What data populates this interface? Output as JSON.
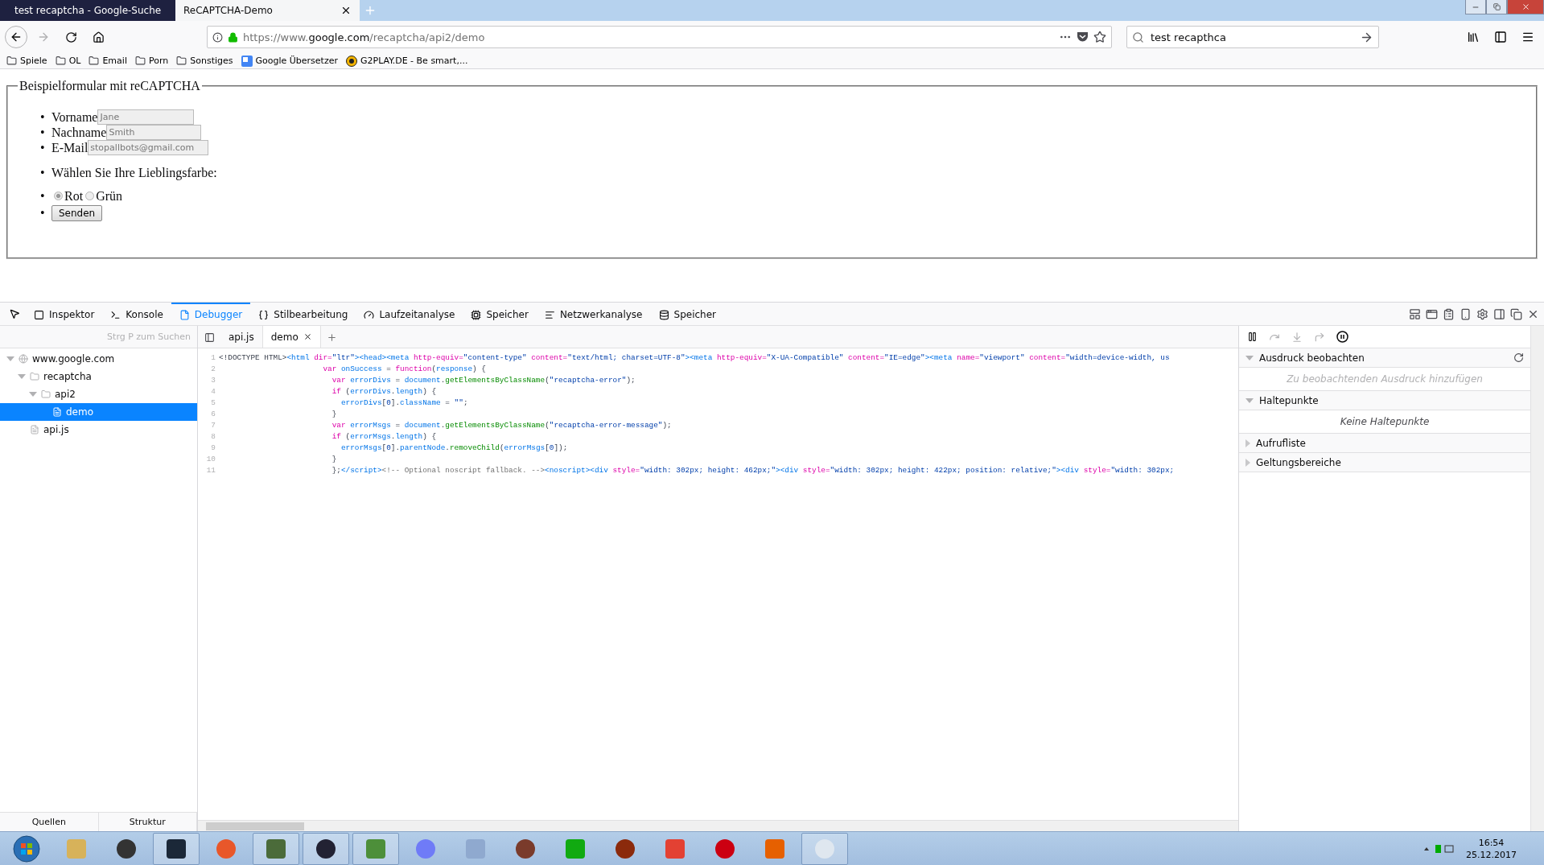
{
  "browser_tabs": [
    {
      "title": "test recaptcha - Google-Suche",
      "selected": false
    },
    {
      "title": "ReCAPTCHA-Demo",
      "selected": true
    }
  ],
  "address": {
    "prefix": "https://www.",
    "host": "google.com",
    "path": "/recaptcha/api2/demo"
  },
  "search_field": {
    "value": "test recapthca"
  },
  "bookmarks": [
    {
      "label": "Spiele",
      "kind": "folder"
    },
    {
      "label": "OL",
      "kind": "folder"
    },
    {
      "label": "Email",
      "kind": "folder"
    },
    {
      "label": "Porn",
      "kind": "folder"
    },
    {
      "label": "Sonstiges",
      "kind": "folder"
    },
    {
      "label": "Google Übersetzer",
      "kind": "translate"
    },
    {
      "label": "G2PLAY.DE - Be smart,...",
      "kind": "site"
    }
  ],
  "form": {
    "legend": "Beispielformular mit reCAPTCHA",
    "items": [
      {
        "kind": "field",
        "bullet": "•",
        "label": "Vorname",
        "placeholder": "Jane"
      },
      {
        "kind": "field",
        "bullet": "•",
        "label": "Nachname",
        "placeholder": "Smith"
      },
      {
        "kind": "field",
        "bullet": "•",
        "label": "E-Mail",
        "placeholder": "stopallbots@gmail.com"
      },
      {
        "kind": "question",
        "bullet": "•",
        "text": "Wählen Sie Ihre Lieblingsfarbe:"
      },
      {
        "kind": "options",
        "bullet": "•",
        "options": [
          {
            "label": "Rot",
            "selected": true
          },
          {
            "label": "Grün",
            "selected": false
          }
        ]
      },
      {
        "kind": "submit",
        "bullet": "•",
        "label": "Senden"
      }
    ]
  },
  "devtools": {
    "tools": [
      {
        "label": "Inspektor",
        "selected": false
      },
      {
        "label": "Konsole",
        "selected": false
      },
      {
        "label": "Debugger",
        "selected": true
      },
      {
        "label": "Stilbearbeitung",
        "selected": false
      },
      {
        "label": "Laufzeitanalyse",
        "selected": false
      },
      {
        "label": "Speicher",
        "selected": false
      },
      {
        "label": "Netzwerkanalyse",
        "selected": false
      },
      {
        "label": "Speicher",
        "selected": false
      }
    ],
    "sources": {
      "search_placeholder": "Strg P zum Suchen",
      "tree": [
        {
          "label": "www.google.com",
          "kind": "domain",
          "expanded": true,
          "selected": false,
          "children": [
            {
              "label": "recaptcha",
              "kind": "folder",
              "expanded": true,
              "selected": false,
              "children": [
                {
                  "label": "api2",
                  "kind": "folder",
                  "expanded": true,
                  "selected": false,
                  "children": [
                    {
                      "label": "demo",
                      "kind": "file",
                      "selected": true
                    }
                  ]
                }
              ]
            },
            {
              "label": "api.js",
              "kind": "file",
              "selected": false
            }
          ]
        }
      ],
      "bottom_tabs": [
        "Quellen",
        "Struktur"
      ]
    },
    "editor": {
      "tabs": [
        {
          "label": "api.js",
          "selected": false
        },
        {
          "label": "demo",
          "selected": true
        }
      ],
      "lines": [
        {
          "number": "1",
          "kind": "top",
          "tokens": [
            {
              "kind": "plain",
              "text": "<!DOCTYPE HTML>"
            },
            {
              "kind": "tag",
              "text": "<html"
            },
            {
              "kind": "attr",
              "text": " dir="
            },
            {
              "kind": "string",
              "text": "\"ltr\""
            },
            {
              "kind": "tag",
              "text": "><head><meta"
            },
            {
              "kind": "attr",
              "text": " http-equiv="
            },
            {
              "kind": "string",
              "text": "\"content-type\""
            },
            {
              "kind": "attr",
              "text": " content="
            },
            {
              "kind": "string",
              "text": "\"text/html; charset=UTF-8\""
            },
            {
              "kind": "tag",
              "text": "><meta"
            },
            {
              "kind": "attr",
              "text": " http-equiv="
            },
            {
              "kind": "string",
              "text": "\"X-UA-Compatible\""
            },
            {
              "kind": "attr",
              "text": " content="
            },
            {
              "kind": "string",
              "text": "\"IE=edge\""
            },
            {
              "kind": "tag",
              "text": "><meta"
            },
            {
              "kind": "attr",
              "text": " name="
            },
            {
              "kind": "string",
              "text": "\"viewport\""
            },
            {
              "kind": "attr",
              "text": " content="
            },
            {
              "kind": "string",
              "text": "\"width=device-width, us"
            }
          ]
        },
        {
          "number": "2",
          "kind": "script",
          "tokens": [
            {
              "kind": "keyword",
              "text": "var"
            },
            {
              "kind": "def",
              "text": " onSuccess"
            },
            {
              "kind": "plain",
              "text": " = "
            },
            {
              "kind": "keyword",
              "text": "function"
            },
            {
              "kind": "plain",
              "text": "("
            },
            {
              "kind": "def",
              "text": "response"
            },
            {
              "kind": "plain",
              "text": ") {"
            }
          ]
        },
        {
          "number": "3",
          "kind": "body",
          "tokens": [
            {
              "kind": "keyword",
              "text": "var"
            },
            {
              "kind": "def",
              "text": " errorDivs"
            },
            {
              "kind": "plain",
              "text": " = "
            },
            {
              "kind": "def",
              "text": "document"
            },
            {
              "kind": "plain",
              "text": "."
            },
            {
              "kind": "prop",
              "text": "getElementsByClassName"
            },
            {
              "kind": "plain",
              "text": "("
            },
            {
              "kind": "string",
              "text": "\"recaptcha-error\""
            },
            {
              "kind": "plain",
              "text": ");"
            }
          ]
        },
        {
          "number": "4",
          "kind": "body",
          "tokens": [
            {
              "kind": "keyword",
              "text": "if"
            },
            {
              "kind": "plain",
              "text": " ("
            },
            {
              "kind": "def",
              "text": "errorDivs"
            },
            {
              "kind": "plain",
              "text": "."
            },
            {
              "kind": "def",
              "text": "length"
            },
            {
              "kind": "plain",
              "text": ") {"
            }
          ]
        },
        {
          "number": "5",
          "kind": "nested",
          "tokens": [
            {
              "kind": "def",
              "text": "errorDivs"
            },
            {
              "kind": "plain",
              "text": "["
            },
            {
              "kind": "string",
              "text": "0"
            },
            {
              "kind": "plain",
              "text": "]."
            },
            {
              "kind": "def",
              "text": "className"
            },
            {
              "kind": "plain",
              "text": " = "
            },
            {
              "kind": "string",
              "text": "\"\""
            },
            {
              "kind": "plain",
              "text": ";"
            }
          ]
        },
        {
          "number": "6",
          "kind": "body",
          "tokens": [
            {
              "kind": "plain",
              "text": "}"
            }
          ]
        },
        {
          "number": "7",
          "kind": "body",
          "tokens": [
            {
              "kind": "keyword",
              "text": "var"
            },
            {
              "kind": "def",
              "text": " errorMsgs"
            },
            {
              "kind": "plain",
              "text": " = "
            },
            {
              "kind": "def",
              "text": "document"
            },
            {
              "kind": "plain",
              "text": "."
            },
            {
              "kind": "prop",
              "text": "getElementsByClassName"
            },
            {
              "kind": "plain",
              "text": "("
            },
            {
              "kind": "string",
              "text": "\"recaptcha-error-message\""
            },
            {
              "kind": "plain",
              "text": ");"
            }
          ]
        },
        {
          "number": "8",
          "kind": "body",
          "tokens": [
            {
              "kind": "keyword",
              "text": "if"
            },
            {
              "kind": "plain",
              "text": " ("
            },
            {
              "kind": "def",
              "text": "errorMsgs"
            },
            {
              "kind": "plain",
              "text": "."
            },
            {
              "kind": "def",
              "text": "length"
            },
            {
              "kind": "plain",
              "text": ") {"
            }
          ]
        },
        {
          "number": "9",
          "kind": "nested",
          "tokens": [
            {
              "kind": "def",
              "text": "errorMsgs"
            },
            {
              "kind": "plain",
              "text": "["
            },
            {
              "kind": "string",
              "text": "0"
            },
            {
              "kind": "plain",
              "text": "]."
            },
            {
              "kind": "def",
              "text": "parentNode"
            },
            {
              "kind": "plain",
              "text": "."
            },
            {
              "kind": "prop",
              "text": "removeChild"
            },
            {
              "kind": "plain",
              "text": "("
            },
            {
              "kind": "def",
              "text": "errorMsgs"
            },
            {
              "kind": "plain",
              "text": "["
            },
            {
              "kind": "string",
              "text": "0"
            },
            {
              "kind": "plain",
              "text": "]);"
            }
          ]
        },
        {
          "number": "10",
          "kind": "body",
          "tokens": [
            {
              "kind": "plain",
              "text": "}"
            }
          ]
        },
        {
          "number": "11",
          "kind": "body",
          "tokens": [
            {
              "kind": "plain",
              "text": "};"
            },
            {
              "kind": "tag",
              "text": "</script>"
            },
            {
              "kind": "comment",
              "text": "<!-- Optional noscript fallback. -->"
            },
            {
              "kind": "tag",
              "text": "<noscript><div"
            },
            {
              "kind": "attr",
              "text": " style="
            },
            {
              "kind": "string",
              "text": "\"width: 302px; height: 462px;\""
            },
            {
              "kind": "tag",
              "text": "><div"
            },
            {
              "kind": "attr",
              "text": " style="
            },
            {
              "kind": "string",
              "text": "\"width: 302px; height: 422px; position: relative;\""
            },
            {
              "kind": "tag",
              "text": "><div"
            },
            {
              "kind": "attr",
              "text": " style="
            },
            {
              "kind": "string",
              "text": "\"width: 302px;"
            }
          ]
        }
      ]
    },
    "panes": [
      {
        "title": "Ausdruck beobachten",
        "kind": "watch",
        "expanded": true,
        "body": "Zu beobachtenden Ausdruck hinzufügen"
      },
      {
        "title": "Haltepunkte",
        "kind": "breakpoints",
        "expanded": true,
        "body": "Keine Haltepunkte"
      },
      {
        "title": "Aufrufliste",
        "kind": "plain",
        "expanded": false
      },
      {
        "title": "Geltungsbereiche",
        "kind": "plain",
        "expanded": false
      }
    ]
  },
  "taskbar": {
    "time": "16:54",
    "date": "25.12.2017"
  }
}
